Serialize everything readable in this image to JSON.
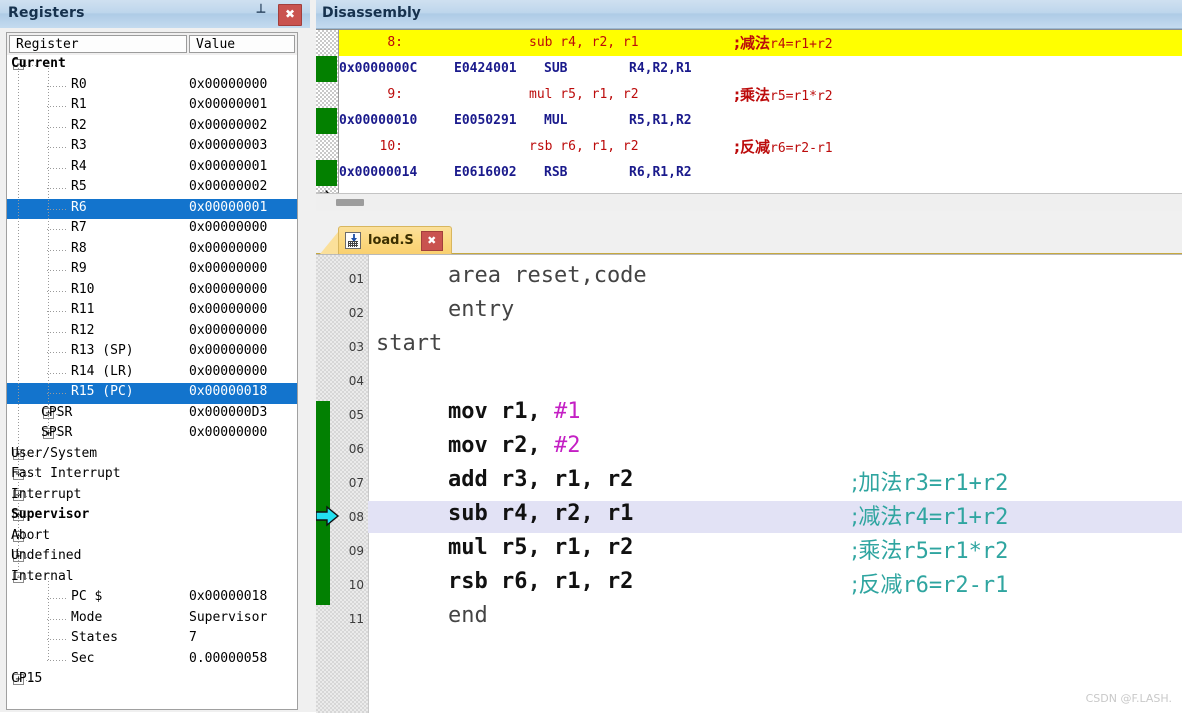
{
  "registers_panel": {
    "title": "Registers",
    "pin_icon": "pin-icon",
    "close_icon": "close-icon",
    "columns": [
      "Register",
      "Value"
    ],
    "rows": [
      {
        "name": "Current",
        "value": "",
        "depth": 0,
        "expander": "-",
        "bold": true,
        "selected": false
      },
      {
        "name": "R0",
        "value": "0x00000000",
        "depth": 2,
        "expander": "",
        "bold": false,
        "selected": false
      },
      {
        "name": "R1",
        "value": "0x00000001",
        "depth": 2,
        "expander": "",
        "bold": false,
        "selected": false
      },
      {
        "name": "R2",
        "value": "0x00000002",
        "depth": 2,
        "expander": "",
        "bold": false,
        "selected": false
      },
      {
        "name": "R3",
        "value": "0x00000003",
        "depth": 2,
        "expander": "",
        "bold": false,
        "selected": false
      },
      {
        "name": "R4",
        "value": "0x00000001",
        "depth": 2,
        "expander": "",
        "bold": false,
        "selected": false
      },
      {
        "name": "R5",
        "value": "0x00000002",
        "depth": 2,
        "expander": "",
        "bold": false,
        "selected": false
      },
      {
        "name": "R6",
        "value": "0x00000001",
        "depth": 2,
        "expander": "",
        "bold": false,
        "selected": true
      },
      {
        "name": "R7",
        "value": "0x00000000",
        "depth": 2,
        "expander": "",
        "bold": false,
        "selected": false
      },
      {
        "name": "R8",
        "value": "0x00000000",
        "depth": 2,
        "expander": "",
        "bold": false,
        "selected": false
      },
      {
        "name": "R9",
        "value": "0x00000000",
        "depth": 2,
        "expander": "",
        "bold": false,
        "selected": false
      },
      {
        "name": "R10",
        "value": "0x00000000",
        "depth": 2,
        "expander": "",
        "bold": false,
        "selected": false
      },
      {
        "name": "R11",
        "value": "0x00000000",
        "depth": 2,
        "expander": "",
        "bold": false,
        "selected": false
      },
      {
        "name": "R12",
        "value": "0x00000000",
        "depth": 2,
        "expander": "",
        "bold": false,
        "selected": false
      },
      {
        "name": "R13 (SP)",
        "value": "0x00000000",
        "depth": 2,
        "expander": "",
        "bold": false,
        "selected": false
      },
      {
        "name": "R14 (LR)",
        "value": "0x00000000",
        "depth": 2,
        "expander": "",
        "bold": false,
        "selected": false
      },
      {
        "name": "R15 (PC)",
        "value": "0x00000018",
        "depth": 2,
        "expander": "",
        "bold": false,
        "selected": true
      },
      {
        "name": "CPSR",
        "value": "0x000000D3",
        "depth": 1,
        "expander": "+",
        "bold": false,
        "selected": false
      },
      {
        "name": "SPSR",
        "value": "0x00000000",
        "depth": 1,
        "expander": "+",
        "bold": false,
        "selected": false
      },
      {
        "name": "User/System",
        "value": "",
        "depth": 0,
        "expander": "+",
        "bold": false,
        "selected": false
      },
      {
        "name": "Fast Interrupt",
        "value": "",
        "depth": 0,
        "expander": "+",
        "bold": false,
        "selected": false
      },
      {
        "name": "Interrupt",
        "value": "",
        "depth": 0,
        "expander": "+",
        "bold": false,
        "selected": false
      },
      {
        "name": "Supervisor",
        "value": "",
        "depth": 0,
        "expander": "+",
        "bold": true,
        "selected": false
      },
      {
        "name": "Abort",
        "value": "",
        "depth": 0,
        "expander": "+",
        "bold": false,
        "selected": false
      },
      {
        "name": "Undefined",
        "value": "",
        "depth": 0,
        "expander": "+",
        "bold": false,
        "selected": false
      },
      {
        "name": "Internal",
        "value": "",
        "depth": 0,
        "expander": "-",
        "bold": false,
        "selected": false
      },
      {
        "name": "PC  $",
        "value": "0x00000018",
        "depth": 2,
        "expander": "",
        "bold": false,
        "selected": false
      },
      {
        "name": "Mode",
        "value": "Supervisor",
        "depth": 2,
        "expander": "",
        "bold": false,
        "selected": false
      },
      {
        "name": "States",
        "value": "7",
        "depth": 2,
        "expander": "",
        "bold": false,
        "selected": false
      },
      {
        "name": "Sec",
        "value": "0.00000058",
        "depth": 2,
        "expander": "",
        "bold": false,
        "selected": false
      },
      {
        "name": "CP15",
        "value": "",
        "depth": 0,
        "expander": "+",
        "bold": false,
        "selected": false
      }
    ]
  },
  "disassembly_panel": {
    "title": "Disassembly",
    "lines": [
      {
        "kind": "source",
        "num": "8:",
        "code": "sub r4, r2, r1",
        "comment_cn": ";减法",
        "comment_en": "r4=r1+r2",
        "highlight": true,
        "marker": "none"
      },
      {
        "kind": "asm",
        "address": "0x0000000C",
        "opcode": "E0424001",
        "mnemonic": "SUB",
        "operands": "R4,R2,R1",
        "marker": "green"
      },
      {
        "kind": "source",
        "num": "9:",
        "code": "mul r5, r1, r2",
        "comment_cn": ";乘法",
        "comment_en": "r5=r1*r2",
        "highlight": false,
        "marker": "none"
      },
      {
        "kind": "asm",
        "address": "0x00000010",
        "opcode": "E0050291",
        "mnemonic": "MUL",
        "operands": "R5,R1,R2",
        "marker": "green"
      },
      {
        "kind": "source",
        "num": "10:",
        "code": "rsb r6, r1, r2",
        "comment_cn": ";反减",
        "comment_en": "r6=r2-r1",
        "highlight": false,
        "marker": "none"
      },
      {
        "kind": "asm",
        "address": "0x00000014",
        "opcode": "E0616002",
        "mnemonic": "RSB",
        "operands": "R6,R1,R2",
        "marker": "green"
      }
    ],
    "partial_last_line": ".........  ........  .....   ..  ..  ..",
    "current_line_marker_icon": "right-arrow-icon",
    "hscrollbar": "horizontal-scrollbar"
  },
  "editor": {
    "tab": {
      "label": "load.S",
      "file_icon": "assembly-file-icon",
      "close_icon": "close-icon"
    },
    "current_line": 8,
    "lines": [
      {
        "num": "01",
        "indent": 4,
        "text": "area reset,code",
        "comment_cn": "",
        "comment_en": "",
        "plain": true,
        "modified": false
      },
      {
        "num": "02",
        "indent": 4,
        "text": "entry",
        "comment_cn": "",
        "comment_en": "",
        "plain": true,
        "modified": false
      },
      {
        "num": "03",
        "indent": 0,
        "text": "start",
        "comment_cn": "",
        "comment_en": "",
        "plain": true,
        "modified": false
      },
      {
        "num": "04",
        "indent": 0,
        "text": "",
        "comment_cn": "",
        "comment_en": "",
        "plain": true,
        "modified": false
      },
      {
        "num": "05",
        "indent": 4,
        "text": "mov r1, ",
        "imm": "#1",
        "comment_cn": "",
        "comment_en": "",
        "plain": false,
        "modified": true
      },
      {
        "num": "06",
        "indent": 4,
        "text": "mov r2, ",
        "imm": "#2",
        "comment_cn": "",
        "comment_en": "",
        "plain": false,
        "modified": true
      },
      {
        "num": "07",
        "indent": 4,
        "text": "add r3, r1, r2",
        "imm": "",
        "comment_cn": ";加法",
        "comment_en": "r3=r1+r2",
        "plain": false,
        "modified": true
      },
      {
        "num": "08",
        "indent": 4,
        "text": "sub r4, r2, r1",
        "imm": "",
        "comment_cn": ";减法",
        "comment_en": "r4=r1+r2",
        "plain": false,
        "modified": true
      },
      {
        "num": "09",
        "indent": 4,
        "text": "mul r5, r1, r2",
        "imm": "",
        "comment_cn": ";乘法",
        "comment_en": "r5=r1*r2",
        "plain": false,
        "modified": true
      },
      {
        "num": "10",
        "indent": 4,
        "text": "rsb r6, r1, r2",
        "imm": "",
        "comment_cn": ";反减",
        "comment_en": "r6=r2-r1",
        "plain": false,
        "modified": true
      },
      {
        "num": "11",
        "indent": 4,
        "text": "end",
        "imm": "",
        "comment_cn": "",
        "comment_en": "",
        "plain": true,
        "modified": false
      }
    ]
  },
  "watermark": "CSDN @F.LASH.",
  "colors": {
    "selection_blue": "#1374cd",
    "disasm_highlight_yellow": "#ffff00",
    "source_line_red": "#bc0b0b",
    "asm_blue": "#1a1a8c",
    "comment_teal": "#2fa5a0",
    "immediate_magenta": "#c41fc4",
    "green_marker": "#028002",
    "current_line_lavender": "#e2e2f5",
    "tab_amber": "#fbd87f",
    "close_red": "#c9534f",
    "titlebar_blue": "#bed6ec"
  }
}
